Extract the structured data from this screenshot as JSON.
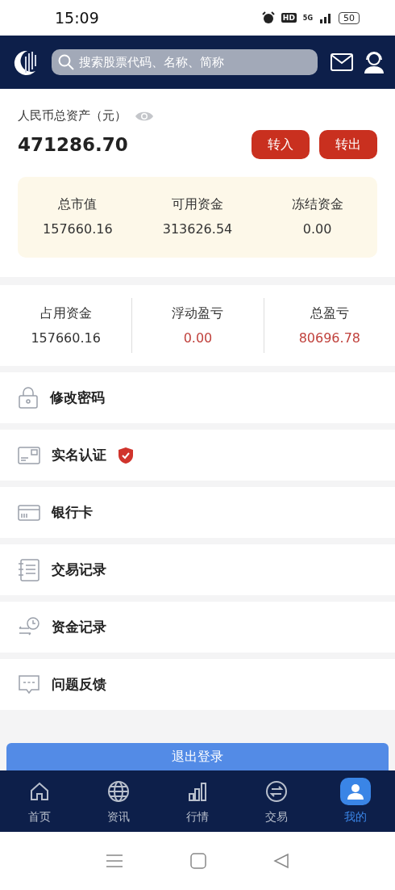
{
  "status_bar": {
    "time": "15:09",
    "hd": "HD",
    "network": "5G",
    "battery": "50"
  },
  "header": {
    "search": {
      "placeholder": "搜索股票代码、名称、简称"
    }
  },
  "assets": {
    "label": "人民币总资产（元）",
    "total": "471286.70",
    "buttons": [
      "转入",
      "转出"
    ]
  },
  "summary": [
    {
      "label": "总市值",
      "value": "157660.16"
    },
    {
      "label": "可用资金",
      "value": "313626.54"
    },
    {
      "label": "冻结资金",
      "value": "0.00"
    }
  ],
  "profit": [
    {
      "label": "占用资金",
      "value": "157660.16",
      "color": "#333333"
    },
    {
      "label": "浮动盈亏",
      "value": "0.00",
      "color": "#c0413c"
    },
    {
      "label": "总盈亏",
      "value": "80696.78",
      "color": "#c0413c"
    }
  ],
  "menu": [
    {
      "label": "修改密码",
      "verified": false
    },
    {
      "label": "实名认证",
      "verified": true
    },
    {
      "label": "银行卡",
      "verified": false
    },
    {
      "label": "交易记录",
      "verified": false
    },
    {
      "label": "资金记录",
      "verified": false
    },
    {
      "label": "问题反馈",
      "verified": false
    }
  ],
  "logout_button": "退出登录",
  "tabs": [
    {
      "label": "首页",
      "selected": false
    },
    {
      "label": "资讯",
      "selected": false
    },
    {
      "label": "行情",
      "selected": false
    },
    {
      "label": "交易",
      "selected": false
    },
    {
      "label": "我的",
      "selected": true
    }
  ]
}
